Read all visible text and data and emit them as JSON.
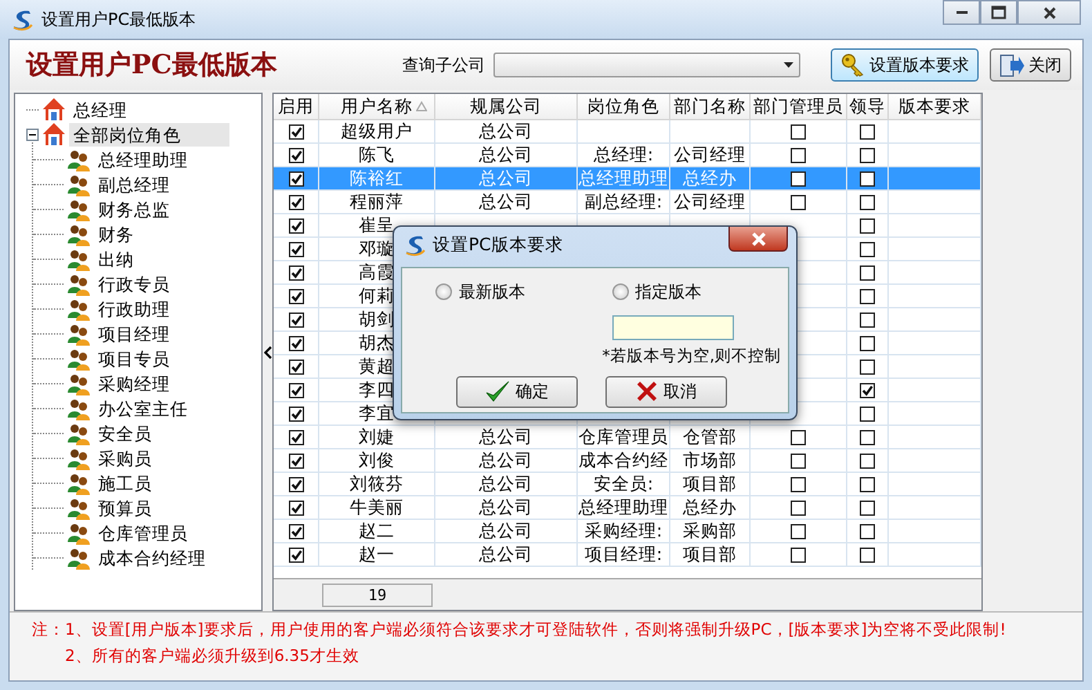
{
  "window": {
    "title": "设置用户PC最低版本"
  },
  "header": {
    "title": "设置用户PC最低版本",
    "filter_label": "查询子公司",
    "buttons": [
      {
        "label": "设置版本要求",
        "kind": "key"
      },
      {
        "label": "关闭",
        "kind": "exit"
      }
    ]
  },
  "tree": {
    "items": [
      {
        "label": "总经理",
        "kind": "home",
        "selected": false
      },
      {
        "label": "全部岗位角色",
        "kind": "home",
        "selected": true,
        "expanded": true,
        "children": [
          {
            "label": "总经理助理",
            "kind": "role",
            "selected": false
          },
          {
            "label": "副总经理",
            "kind": "role",
            "selected": false
          },
          {
            "label": "财务总监",
            "kind": "role",
            "selected": false
          },
          {
            "label": "财务",
            "kind": "role",
            "selected": false
          },
          {
            "label": "出纳",
            "kind": "role",
            "selected": false
          },
          {
            "label": "行政专员",
            "kind": "role",
            "selected": false
          },
          {
            "label": "行政助理",
            "kind": "role",
            "selected": false
          },
          {
            "label": "项目经理",
            "kind": "role",
            "selected": false
          },
          {
            "label": "项目专员",
            "kind": "role",
            "selected": false
          },
          {
            "label": "采购经理",
            "kind": "role",
            "selected": false
          },
          {
            "label": "办公室主任",
            "kind": "role",
            "selected": false
          },
          {
            "label": "安全员",
            "kind": "role",
            "selected": false
          },
          {
            "label": "采购员",
            "kind": "role",
            "selected": false
          },
          {
            "label": "施工员",
            "kind": "role",
            "selected": false
          },
          {
            "label": "预算员",
            "kind": "role",
            "selected": false
          },
          {
            "label": "仓库管理员",
            "kind": "role",
            "selected": false
          },
          {
            "label": "成本合约经理",
            "kind": "role",
            "selected": false
          }
        ]
      }
    ]
  },
  "table": {
    "columns": [
      {
        "label": "启用",
        "sorted": false
      },
      {
        "label": "用户名称",
        "sorted": true
      },
      {
        "label": "规属公司",
        "sorted": false
      },
      {
        "label": "岗位角色",
        "sorted": false
      },
      {
        "label": "部门名称",
        "sorted": false
      },
      {
        "label": "部门管理员",
        "sorted": false
      },
      {
        "label": "领导",
        "sorted": false
      },
      {
        "label": "版本要求",
        "sorted": false
      }
    ],
    "rows": [
      {
        "enabled": true,
        "name": "超级用户",
        "company": "总公司",
        "dept_admin": false,
        "leader": false,
        "selected": false
      },
      {
        "enabled": true,
        "name": "陈飞",
        "company": "总公司",
        "role": "总经理:",
        "dept": "公司经理",
        "dept_admin": false,
        "leader": false,
        "selected": false
      },
      {
        "enabled": true,
        "name": "陈裕红",
        "company": "总公司",
        "role": "总经理助理",
        "dept": "总经办",
        "dept_admin": false,
        "leader": false,
        "selected": true
      },
      {
        "enabled": true,
        "name": "程丽萍",
        "company": "总公司",
        "role": "副总经理:",
        "dept": "公司经理",
        "dept_admin": false,
        "leader": false,
        "selected": false
      },
      {
        "enabled": true,
        "name": "崔呈",
        "leader": false,
        "selected": false
      },
      {
        "enabled": true,
        "name": "邓璇",
        "leader": false,
        "selected": false
      },
      {
        "enabled": true,
        "name": "高霞",
        "leader": false,
        "selected": false
      },
      {
        "enabled": true,
        "name": "何莉",
        "leader": false,
        "selected": false
      },
      {
        "enabled": true,
        "name": "胡剑",
        "leader": false,
        "selected": false
      },
      {
        "enabled": true,
        "name": "胡杰",
        "leader": false,
        "selected": false
      },
      {
        "enabled": true,
        "name": "黄超",
        "leader": false,
        "selected": false
      },
      {
        "enabled": true,
        "name": "李四",
        "leader": true,
        "selected": false
      },
      {
        "enabled": true,
        "name": "李宜",
        "leader": false,
        "selected": false
      },
      {
        "enabled": true,
        "name": "刘婕",
        "company": "总公司",
        "role": "仓库管理员",
        "dept": "仓管部",
        "dept_admin": false,
        "leader": false,
        "selected": false
      },
      {
        "enabled": true,
        "name": "刘俊",
        "company": "总公司",
        "role": "成本合约经",
        "dept": "市场部",
        "dept_admin": false,
        "leader": false,
        "selected": false
      },
      {
        "enabled": true,
        "name": "刘筱芬",
        "company": "总公司",
        "role": "安全员:",
        "dept": "项目部",
        "dept_admin": false,
        "leader": false,
        "selected": false
      },
      {
        "enabled": true,
        "name": "牛美丽",
        "company": "总公司",
        "role": "总经理助理",
        "dept": "总经办",
        "dept_admin": false,
        "leader": false,
        "selected": false
      },
      {
        "enabled": true,
        "name": "赵二",
        "company": "总公司",
        "role": "采购经理:",
        "dept": "采购部",
        "dept_admin": false,
        "leader": false,
        "selected": false
      },
      {
        "enabled": true,
        "name": "赵一",
        "company": "总公司",
        "role": "项目经理:",
        "dept": "项目部",
        "dept_admin": false,
        "leader": false,
        "selected": false
      }
    ],
    "count": "19"
  },
  "notes": {
    "label": "注：",
    "lines": [
      "1、设置[用户版本]要求后，用户使用的客户端必须符合该要求才可登陆软件，否则将强制升级PC，[版本要求]为空将不受此限制!",
      "2、所有的客户端必须升级到6.35才生效"
    ]
  },
  "dialog": {
    "title": "设置PC版本要求",
    "options": [
      {
        "label": "最新版本",
        "selected": false
      },
      {
        "label": "指定版本",
        "selected": false
      }
    ],
    "hint": "*若版本号为空,则不控制",
    "buttons": [
      {
        "label": "确定",
        "kind": "ok"
      },
      {
        "label": "取消",
        "kind": "cancel"
      }
    ]
  }
}
